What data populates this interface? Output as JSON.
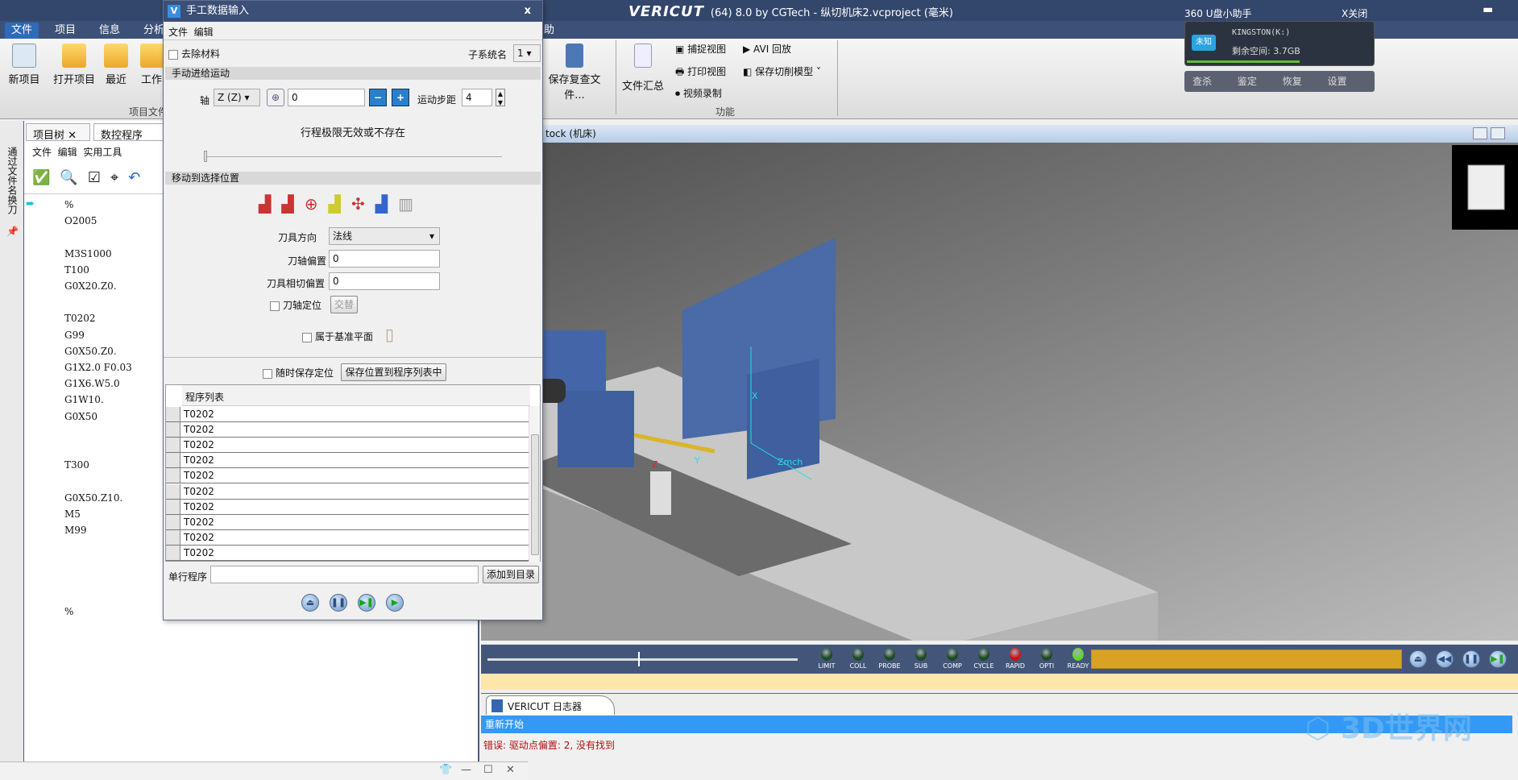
{
  "app": {
    "title_brand": "VERICUT",
    "title_rest": "(64) 8.0 by CGTech - 纵切机床2.vcproject (毫米)"
  },
  "ribbon": {
    "tabs": [
      "文件",
      "项目",
      "信息",
      "分析",
      "助"
    ],
    "buttons": [
      {
        "label": "新项目"
      },
      {
        "label": "打开项目"
      },
      {
        "label": "最近"
      },
      {
        "label": "工作"
      },
      {
        "label": "保存复查文件..."
      },
      {
        "label": "文件汇总"
      }
    ],
    "small_buttons": [
      "捕捉视图",
      "打印视图",
      "视频录制",
      "AVI 回放",
      "保存切削模型"
    ],
    "group_labels": [
      "项目文件",
      "功能"
    ]
  },
  "usb_helper": {
    "title": "360 U盘小助手",
    "close": "X关闭",
    "drive": "KINGSTON(K:)",
    "free": "剩余空间: 3.7GB",
    "badge": "未知",
    "actions": [
      "查杀",
      "鉴定",
      "恢复",
      "设置"
    ],
    "usage_percent": 60
  },
  "left_strip": {
    "label": "通过文件名换刀"
  },
  "left_panel": {
    "tabs": [
      "项目树",
      "数控程序"
    ],
    "menu": [
      "文件",
      "编辑",
      "实用工具"
    ],
    "code_lines": [
      "%",
      "O2005",
      "",
      "M3S1000",
      "T100",
      "G0X20.Z0.",
      "",
      "T0202",
      "G99",
      "G0X50.Z0.",
      "G1X2.0 F0.03",
      "G1X6.W5.0",
      "G1W10.",
      "G0X50",
      "",
      "",
      "T300",
      "",
      " G0X50.Z10.",
      "M5",
      "M99",
      "",
      "",
      "",
      "",
      "%"
    ]
  },
  "dialog": {
    "title": "手工数据输入",
    "close": "x",
    "menu": [
      "文件",
      "编辑"
    ],
    "remove_material": "去除材料",
    "subsystem_label": "子系统名",
    "subsystem_value": "1",
    "section_jog": "手动进给运动",
    "axis_label": "轴",
    "axis_value": "Z (Z)",
    "position_value": "0",
    "step_label": "运动步距",
    "step_value": "4",
    "travel_msg": "行程极限无效或不存在",
    "section_move": "移动到选择位置",
    "tool_dir_label": "刀具方向",
    "tool_dir_value": "法线",
    "axis_offset_label": "刀轴偏置",
    "axis_offset_value": "0",
    "tangent_offset_label": "刀具相切偏置",
    "tangent_offset_value": "0",
    "axis_locate": "刀轴定位",
    "alternate": "交替",
    "base_plane": "属于基准平面",
    "save_anytime": "随时保存定位",
    "save_to_list": "保存位置到程序列表中",
    "list_header": "程序列表",
    "list_rows": [
      "T0202",
      "T0202",
      "T0202",
      "T0202",
      "T0202",
      "T0202",
      "T0202",
      "T0202",
      "T0202",
      "T0202"
    ],
    "single_label": "单行程序",
    "single_value": "",
    "add_to_list": "添加到目录"
  },
  "viewport": {
    "title": "tock (机床)",
    "axis_labels": [
      "X",
      "Y",
      "Z",
      "Zmch"
    ]
  },
  "status_leds": [
    {
      "label": "LIMIT",
      "color": "#1d4a22"
    },
    {
      "label": "COLL",
      "color": "#1d4a22"
    },
    {
      "label": "PROBE",
      "color": "#1d4a22"
    },
    {
      "label": "SUB",
      "color": "#1d4a22"
    },
    {
      "label": "COMP",
      "color": "#1d4a22"
    },
    {
      "label": "CYCLE",
      "color": "#1d4a22"
    },
    {
      "label": "RAPID",
      "color": "#d01010"
    },
    {
      "label": "OPTI",
      "color": "#1d4a22"
    },
    {
      "label": "READY",
      "color": "#5ed62a"
    }
  ],
  "progress": {
    "color": "#d9a224"
  },
  "logger": {
    "tab": "VERICUT 日志器",
    "selected": "重新开始",
    "error": "错误: 驱动点偏置: 2, 没有找到"
  },
  "watermark": "3D世界网"
}
